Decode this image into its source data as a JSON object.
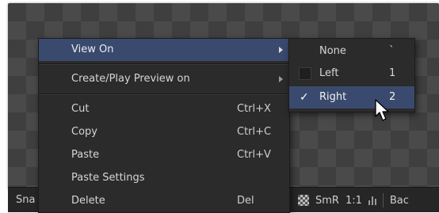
{
  "toolbar": {
    "left_text": "Sna",
    "snap_label": "SmR",
    "ratio": "1:1",
    "right_text": "Bac"
  },
  "menu": {
    "items": [
      {
        "label": "View On",
        "shortcut": "",
        "submenu": true
      },
      {
        "label": "Create/Play Preview on",
        "shortcut": "",
        "submenu": true
      },
      {
        "label": "Cut",
        "shortcut": "Ctrl+X"
      },
      {
        "label": "Copy",
        "shortcut": "Ctrl+C"
      },
      {
        "label": "Paste",
        "shortcut": "Ctrl+V"
      },
      {
        "label": "Paste Settings",
        "shortcut": ""
      },
      {
        "label": "Delete",
        "shortcut": "Del"
      }
    ]
  },
  "submenu": {
    "items": [
      {
        "label": "None",
        "key": "`",
        "checked": false
      },
      {
        "label": "Left",
        "key": "1",
        "checked": false
      },
      {
        "label": "Right",
        "key": "2",
        "checked": true
      }
    ],
    "check_glyph": "✓"
  },
  "colors": {
    "highlight": "#3a4a6e",
    "menu_bg": "#2b2b2b",
    "checker_dark": "#3f3f3f",
    "checker_light": "#4a4a4a"
  }
}
